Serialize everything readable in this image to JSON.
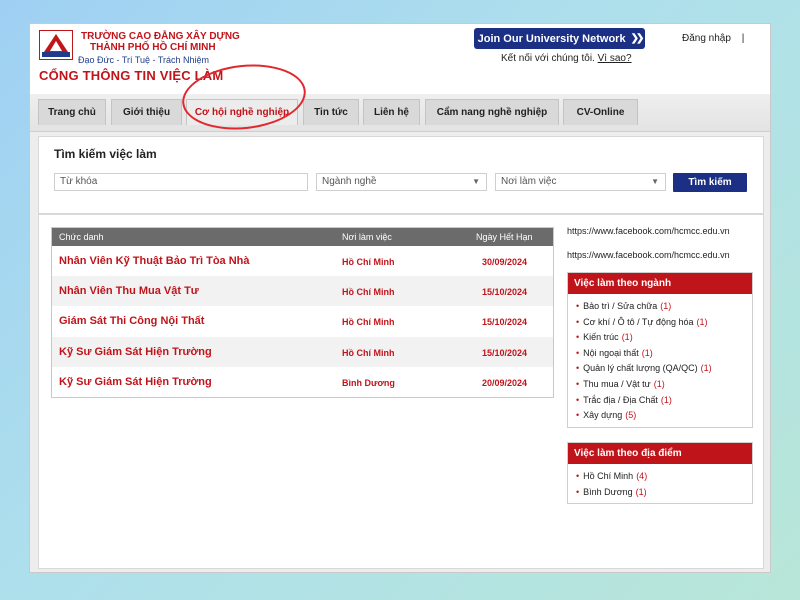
{
  "header": {
    "school_line1": "TRƯỜNG CAO ĐẲNG XÂY DỰNG",
    "school_line2": "THÀNH PHỐ HỒ CHÍ MINH",
    "motto": "Đạo Đức - Trí Tuệ - Trách Nhiệm",
    "portal_title": "CỔNG THÔNG TIN VIỆC LÀM",
    "network_button": "Join Our University Network",
    "connect_text": "Kết nối với chúng tôi.",
    "connect_link": "Vì sao?",
    "login": "Đăng nhập",
    "login_separator": "|"
  },
  "nav": {
    "tabs": [
      {
        "label": "Trang chủ"
      },
      {
        "label": "Giới thiệu"
      },
      {
        "label": "Cơ hội nghề nghiệp"
      },
      {
        "label": "Tin tức"
      },
      {
        "label": "Liên hệ"
      },
      {
        "label": "Cẩm nang nghề nghiệp"
      },
      {
        "label": "CV-Online"
      }
    ],
    "active_index": 2
  },
  "search": {
    "title": "Tìm kiếm việc làm",
    "keyword_placeholder": "Từ khóa",
    "industry_value": "Ngành nghề",
    "location_value": "Nơi làm việc",
    "button_label": "Tìm kiếm"
  },
  "jobs": {
    "columns": [
      "Chức danh",
      "Nơi làm việc",
      "Ngày Hết Hạn"
    ],
    "rows": [
      {
        "title": "Nhân Viên Kỹ Thuật Bảo Trì Tòa Nhà",
        "location": "Hồ Chí Minh",
        "deadline": "30/09/2024"
      },
      {
        "title": "Nhân Viên Thu Mua Vật Tư",
        "location": "Hồ Chí Minh",
        "deadline": "15/10/2024"
      },
      {
        "title": "Giám Sát Thi Công Nội Thất",
        "location": "Hồ Chí Minh",
        "deadline": "15/10/2024"
      },
      {
        "title": "Kỹ Sư Giám Sát Hiện Trường",
        "location": "Hồ Chí Minh",
        "deadline": "15/10/2024"
      },
      {
        "title": "Kỹ Sư Giám Sát Hiện Trường",
        "location": "Bình Dương",
        "deadline": "20/09/2024"
      }
    ]
  },
  "sidebar": {
    "links": [
      "https://www.facebook.com/hcmcc.edu.vn",
      "https://www.facebook.com/hcmcc.edu.vn"
    ],
    "by_industry": {
      "title": "Việc làm theo ngành",
      "items": [
        {
          "label": "Bảo trì / Sửa chữa",
          "count": "(1)"
        },
        {
          "label": "Cơ khí / Ô tô / Tự động hóa",
          "count": "(1)"
        },
        {
          "label": "Kiến trúc",
          "count": "(1)"
        },
        {
          "label": "Nội ngoại thất",
          "count": "(1)"
        },
        {
          "label": "Quản lý chất lượng (QA/QC)",
          "count": "(1)"
        },
        {
          "label": "Thu mua / Vật tư",
          "count": "(1)"
        },
        {
          "label": "Trắc địa / Địa Chất",
          "count": "(1)"
        },
        {
          "label": "Xây dựng",
          "count": "(5)"
        }
      ]
    },
    "by_location": {
      "title": "Việc làm theo địa điểm",
      "items": [
        {
          "label": "Hồ Chí Minh",
          "count": "(4)"
        },
        {
          "label": "Bình Dương",
          "count": "(1)"
        }
      ]
    }
  },
  "colors": {
    "brand_red": "#c0141b",
    "brand_blue": "#1b2f85",
    "highlight_circle": "#e0282e"
  }
}
